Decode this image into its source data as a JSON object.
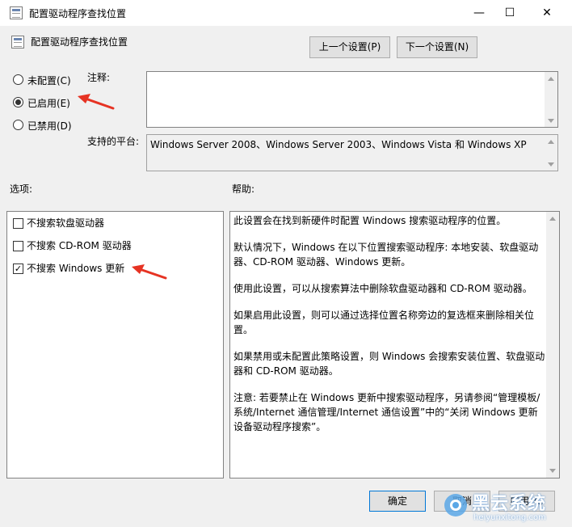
{
  "window": {
    "title": "配置驱动程序查找位置",
    "minimize": "—",
    "maximize": "☐",
    "close": "✕"
  },
  "header": {
    "policy_name": "配置驱动程序查找位置",
    "prev_button": "上一个设置(P)",
    "next_button": "下一个设置(N)"
  },
  "state": {
    "options": [
      {
        "label": "未配置(C)",
        "selected": false
      },
      {
        "label": "已启用(E)",
        "selected": true
      },
      {
        "label": "已禁用(D)",
        "selected": false
      }
    ]
  },
  "comment": {
    "label": "注释:",
    "value": ""
  },
  "platform": {
    "label": "支持的平台:",
    "value": "Windows Server 2008、Windows Server 2003、Windows Vista 和 Windows XP"
  },
  "options_section": {
    "label": "选项:",
    "items": [
      {
        "label": "不搜索软盘驱动器",
        "checked": false
      },
      {
        "label": "不搜索 CD-ROM 驱动器",
        "checked": false
      },
      {
        "label": "不搜索 Windows 更新",
        "checked": true
      }
    ]
  },
  "help_section": {
    "label": "帮助:",
    "paragraphs": [
      "此设置会在找到新硬件时配置 Windows 搜索驱动程序的位置。",
      "默认情况下，Windows 在以下位置搜索驱动程序: 本地安装、软盘驱动器、CD-ROM 驱动器、Windows 更新。",
      "使用此设置，可以从搜索算法中删除软盘驱动器和 CD-ROM 驱动器。",
      "如果启用此设置，则可以通过选择位置名称旁边的复选框来删除相关位置。",
      "如果禁用或未配置此策略设置，则 Windows 会搜索安装位置、软盘驱动器和 CD-ROM 驱动器。",
      "注意: 若要禁止在 Windows 更新中搜索驱动程序，另请参阅“管理模板/系统/Internet 通信管理/Internet 通信设置”中的“关闭 Windows 更新设备驱动程序搜索”。"
    ]
  },
  "footer": {
    "ok": "确定",
    "cancel": "取消",
    "apply": "应用(A)"
  },
  "watermark": {
    "text": "黑云系统",
    "url": "heiyunxitong.com"
  },
  "colors": {
    "accent": "#0078d7",
    "annotation_arrow": "#e63323"
  }
}
